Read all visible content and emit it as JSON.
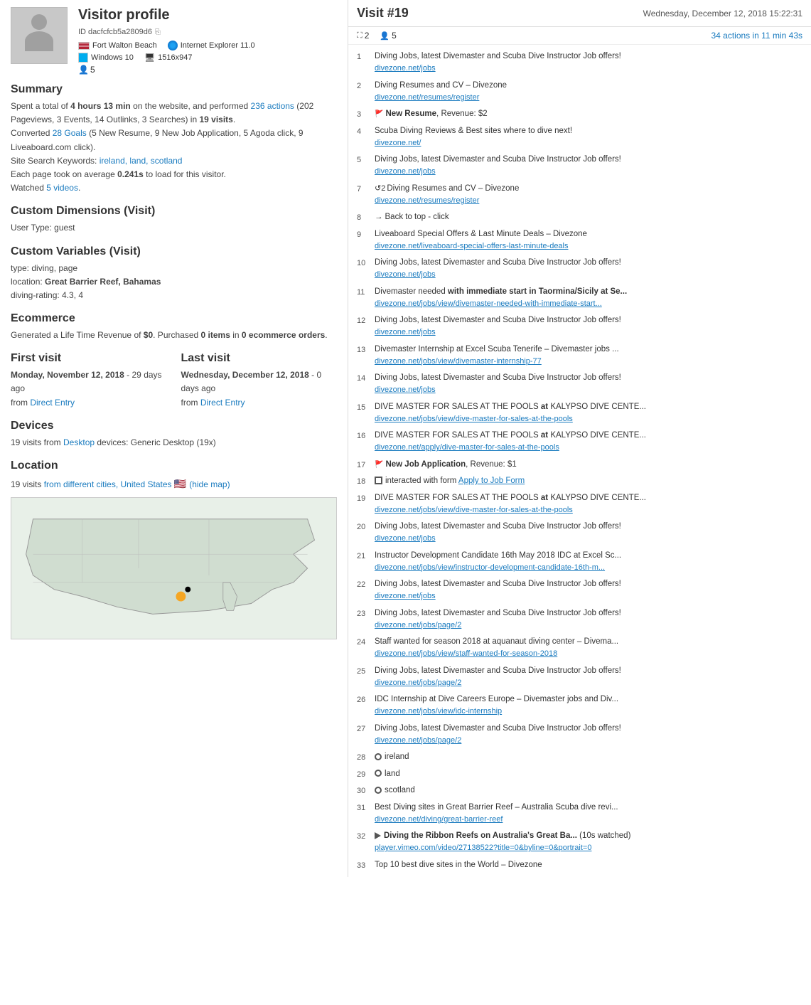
{
  "window": {
    "minimize_label": "−",
    "help_label": "?",
    "close_label": "×"
  },
  "visitor": {
    "title": "Visitor profile",
    "id": "ID dacfcfcb5a2809d6",
    "location": "Fort Walton Beach",
    "browser": "Internet Explorer 11.0",
    "os": "Windows 10",
    "resolution": "1516x947",
    "user_count": "5"
  },
  "summary": {
    "title": "Summary",
    "text1": "Spent a total of ",
    "duration": "4 hours 13 min",
    "text2": " on the website, and performed ",
    "actions_count": "236 actions",
    "actions_detail": " (202 Pageviews, 3 Events, 14 Outlinks, 3 Searches) in ",
    "visits": "19 visits",
    "text3": ".",
    "converted_text": "Converted ",
    "goals": "28 Goals",
    "goals_detail": " (5 New Resume, 9 New Job Application, 5 Agoda click, 9 Liveaboard.com click).",
    "search_label": "Site Search Keywords: ",
    "keywords": "ireland, land, scotland",
    "page_load": "Each page took on average ",
    "load_time": "0.241s",
    "load_text": " to load for this visitor.",
    "videos": "Watched ",
    "video_count": "5 videos",
    "video_dot": "."
  },
  "custom_dimensions": {
    "title": "Custom Dimensions (Visit)",
    "user_type_label": "User Type: ",
    "user_type": "guest"
  },
  "custom_variables": {
    "title": "Custom Variables (Visit)",
    "type_label": "type: ",
    "type_value": "diving, page",
    "location_label": "location: ",
    "location_value": "Great Barrier Reef, Bahamas",
    "rating_label": "diving-rating: ",
    "rating_value": "4.3, 4"
  },
  "ecommerce": {
    "title": "Ecommerce",
    "text": "Generated a Life Time Revenue of ",
    "revenue": "$0",
    "text2": ". Purchased ",
    "items": "0 items",
    "text3": " in ",
    "orders": "0 ecommerce orders",
    "text4": "."
  },
  "first_visit": {
    "title": "First visit",
    "date": "Monday, November 12, 2018",
    "days_ago": " - 29 days ago",
    "from": "from ",
    "source": "Direct Entry"
  },
  "last_visit": {
    "title": "Last visit",
    "date": "Wednesday, December 12, 2018",
    "days_ago": " - 0 days ago",
    "from": "from ",
    "source": "Direct Entry"
  },
  "devices": {
    "title": "Devices",
    "text": "19 visits from ",
    "device_type": "Desktop",
    "text2": " devices: Generic Desktop (19x)"
  },
  "location": {
    "title": "Location",
    "text": "19 visits ",
    "link": "from different cities, United States",
    "hide_map": "(hide map)"
  },
  "visit": {
    "title": "Visit #19",
    "datetime": "Wednesday, December 12, 2018 15:22:31",
    "pages_count": "2",
    "users_count": "5",
    "actions_summary": "34 actions in 11 min 43s"
  },
  "actions": [
    {
      "num": "1",
      "title": "Diving Jobs, latest Divemaster and Scuba Dive Instructor Job offers!",
      "url": "divezone.net/jobs",
      "type": "page"
    },
    {
      "num": "2",
      "title": "Diving Resumes and CV – Divezone",
      "url": "divezone.net/resumes/register",
      "type": "page"
    },
    {
      "num": "3",
      "title": "New Resume",
      "revenue": "Revenue: $2",
      "url": "",
      "type": "goal"
    },
    {
      "num": "4",
      "title": "Scuba Diving Reviews & Best sites where to dive next!",
      "url": "divezone.net/",
      "type": "page"
    },
    {
      "num": "5",
      "title": "Diving Jobs, latest Divemaster and Scuba Dive Instructor Job offers!",
      "url": "divezone.net/jobs",
      "type": "page"
    },
    {
      "num": "7",
      "title": "Diving Resumes and CV – Divezone",
      "url": "divezone.net/resumes/register",
      "type": "page",
      "has_rotate": true,
      "rotate_count": "2"
    },
    {
      "num": "8",
      "title": "Back to top - click",
      "url": "",
      "type": "event",
      "has_arrow": true
    },
    {
      "num": "9",
      "title": "Liveaboard Special Offers & Last Minute Deals – Divezone",
      "url": "divezone.net/liveaboard-special-offers-last-minute-deals",
      "type": "page"
    },
    {
      "num": "10",
      "title": "Diving Jobs, latest Divemaster and Scuba Dive Instructor Job offers!",
      "url": "divezone.net/jobs",
      "type": "page"
    },
    {
      "num": "11",
      "title": "Divemaster needed with immediate start in Taormina/Sicily at Se...",
      "url": "divezone.net/jobs/view/divemaster-needed-with-immediate-start...",
      "type": "page",
      "has_bold_word": true,
      "bold_word": "with immediate start in Taormina/Sicily at Se..."
    },
    {
      "num": "12",
      "title": "Diving Jobs, latest Divemaster and Scuba Dive Instructor Job offers!",
      "url": "divezone.net/jobs",
      "type": "page"
    },
    {
      "num": "13",
      "title": "Divemaster Internship at Excel Scuba Tenerife – Divemaster jobs ...",
      "url": "divezone.net/jobs/view/divemaster-internship-77",
      "type": "page"
    },
    {
      "num": "14",
      "title": "Diving Jobs, latest Divemaster and Scuba Dive Instructor Job offers!",
      "url": "divezone.net/jobs",
      "type": "page"
    },
    {
      "num": "15",
      "title": "DIVE MASTER FOR SALES AT THE POOLS at KALYPSO DIVE CENTE...",
      "url": "divezone.net/jobs/view/dive-master-for-sales-at-the-pools",
      "type": "page",
      "bold_at": true
    },
    {
      "num": "16",
      "title": "DIVE MASTER FOR SALES AT THE POOLS at KALYPSO DIVE CENTE...",
      "url": "divezone.net/apply/dive-master-for-sales-at-the-pools",
      "type": "page",
      "bold_at": true
    },
    {
      "num": "17",
      "title": "New Job Application",
      "revenue": "Revenue: $1",
      "url": "",
      "type": "goal"
    },
    {
      "num": "18",
      "title": "interacted with form",
      "link_text": "Apply to Job Form",
      "url": "",
      "type": "form"
    },
    {
      "num": "19",
      "title": "DIVE MASTER FOR SALES AT THE POOLS at KALYPSO DIVE CENTE...",
      "url": "divezone.net/jobs/view/dive-master-for-sales-at-the-pools",
      "type": "page",
      "bold_at": true
    },
    {
      "num": "20",
      "title": "Diving Jobs, latest Divemaster and Scuba Dive Instructor Job offers!",
      "url": "divezone.net/jobs",
      "type": "page"
    },
    {
      "num": "21",
      "title": "Instructor Development Candidate 16th May 2018 IDC at Excel Sc...",
      "url": "divezone.net/jobs/view/instructor-development-candidate-16th-m...",
      "type": "page"
    },
    {
      "num": "22",
      "title": "Diving Jobs, latest Divemaster and Scuba Dive Instructor Job offers!",
      "url": "divezone.net/jobs",
      "type": "page"
    },
    {
      "num": "23",
      "title": "Diving Jobs, latest Divemaster and Scuba Dive Instructor Job offers!",
      "url": "divezone.net/jobs/page/2",
      "type": "page"
    },
    {
      "num": "24",
      "title": "Staff wanted for season 2018 at aquanaut diving center – Divema...",
      "url": "divezone.net/jobs/view/staff-wanted-for-season-2018",
      "type": "page"
    },
    {
      "num": "25",
      "title": "Diving Jobs, latest Divemaster and Scuba Dive Instructor Job offers!",
      "url": "divezone.net/jobs/page/2",
      "type": "page"
    },
    {
      "num": "26",
      "title": "IDC Internship at Dive Careers Europe – Divemaster jobs and Div...",
      "url": "divezone.net/jobs/view/idc-internship",
      "type": "page"
    },
    {
      "num": "27",
      "title": "Diving Jobs, latest Divemaster and Scuba Dive Instructor Job offers!",
      "url": "divezone.net/jobs/page/2",
      "type": "page"
    },
    {
      "num": "28",
      "title": "ireland",
      "url": "",
      "type": "search"
    },
    {
      "num": "29",
      "title": "land",
      "url": "",
      "type": "search"
    },
    {
      "num": "30",
      "title": "scotland",
      "url": "",
      "type": "search"
    },
    {
      "num": "31",
      "title": "Best Diving sites in Great Barrier Reef – Australia Scuba dive revi...",
      "url": "divezone.net/diving/great-barrier-reef",
      "type": "page"
    },
    {
      "num": "32",
      "title": "Diving the Ribbon Reefs on Australia's Great Ba...",
      "url": "player.vimeo.com/video/27138522?title=0&byline=0&portrait=0",
      "type": "video",
      "duration": "(10s watched)"
    },
    {
      "num": "33",
      "title": "Top 10 best dive sites in the World – Divezone",
      "url": "",
      "type": "page_partial"
    }
  ]
}
